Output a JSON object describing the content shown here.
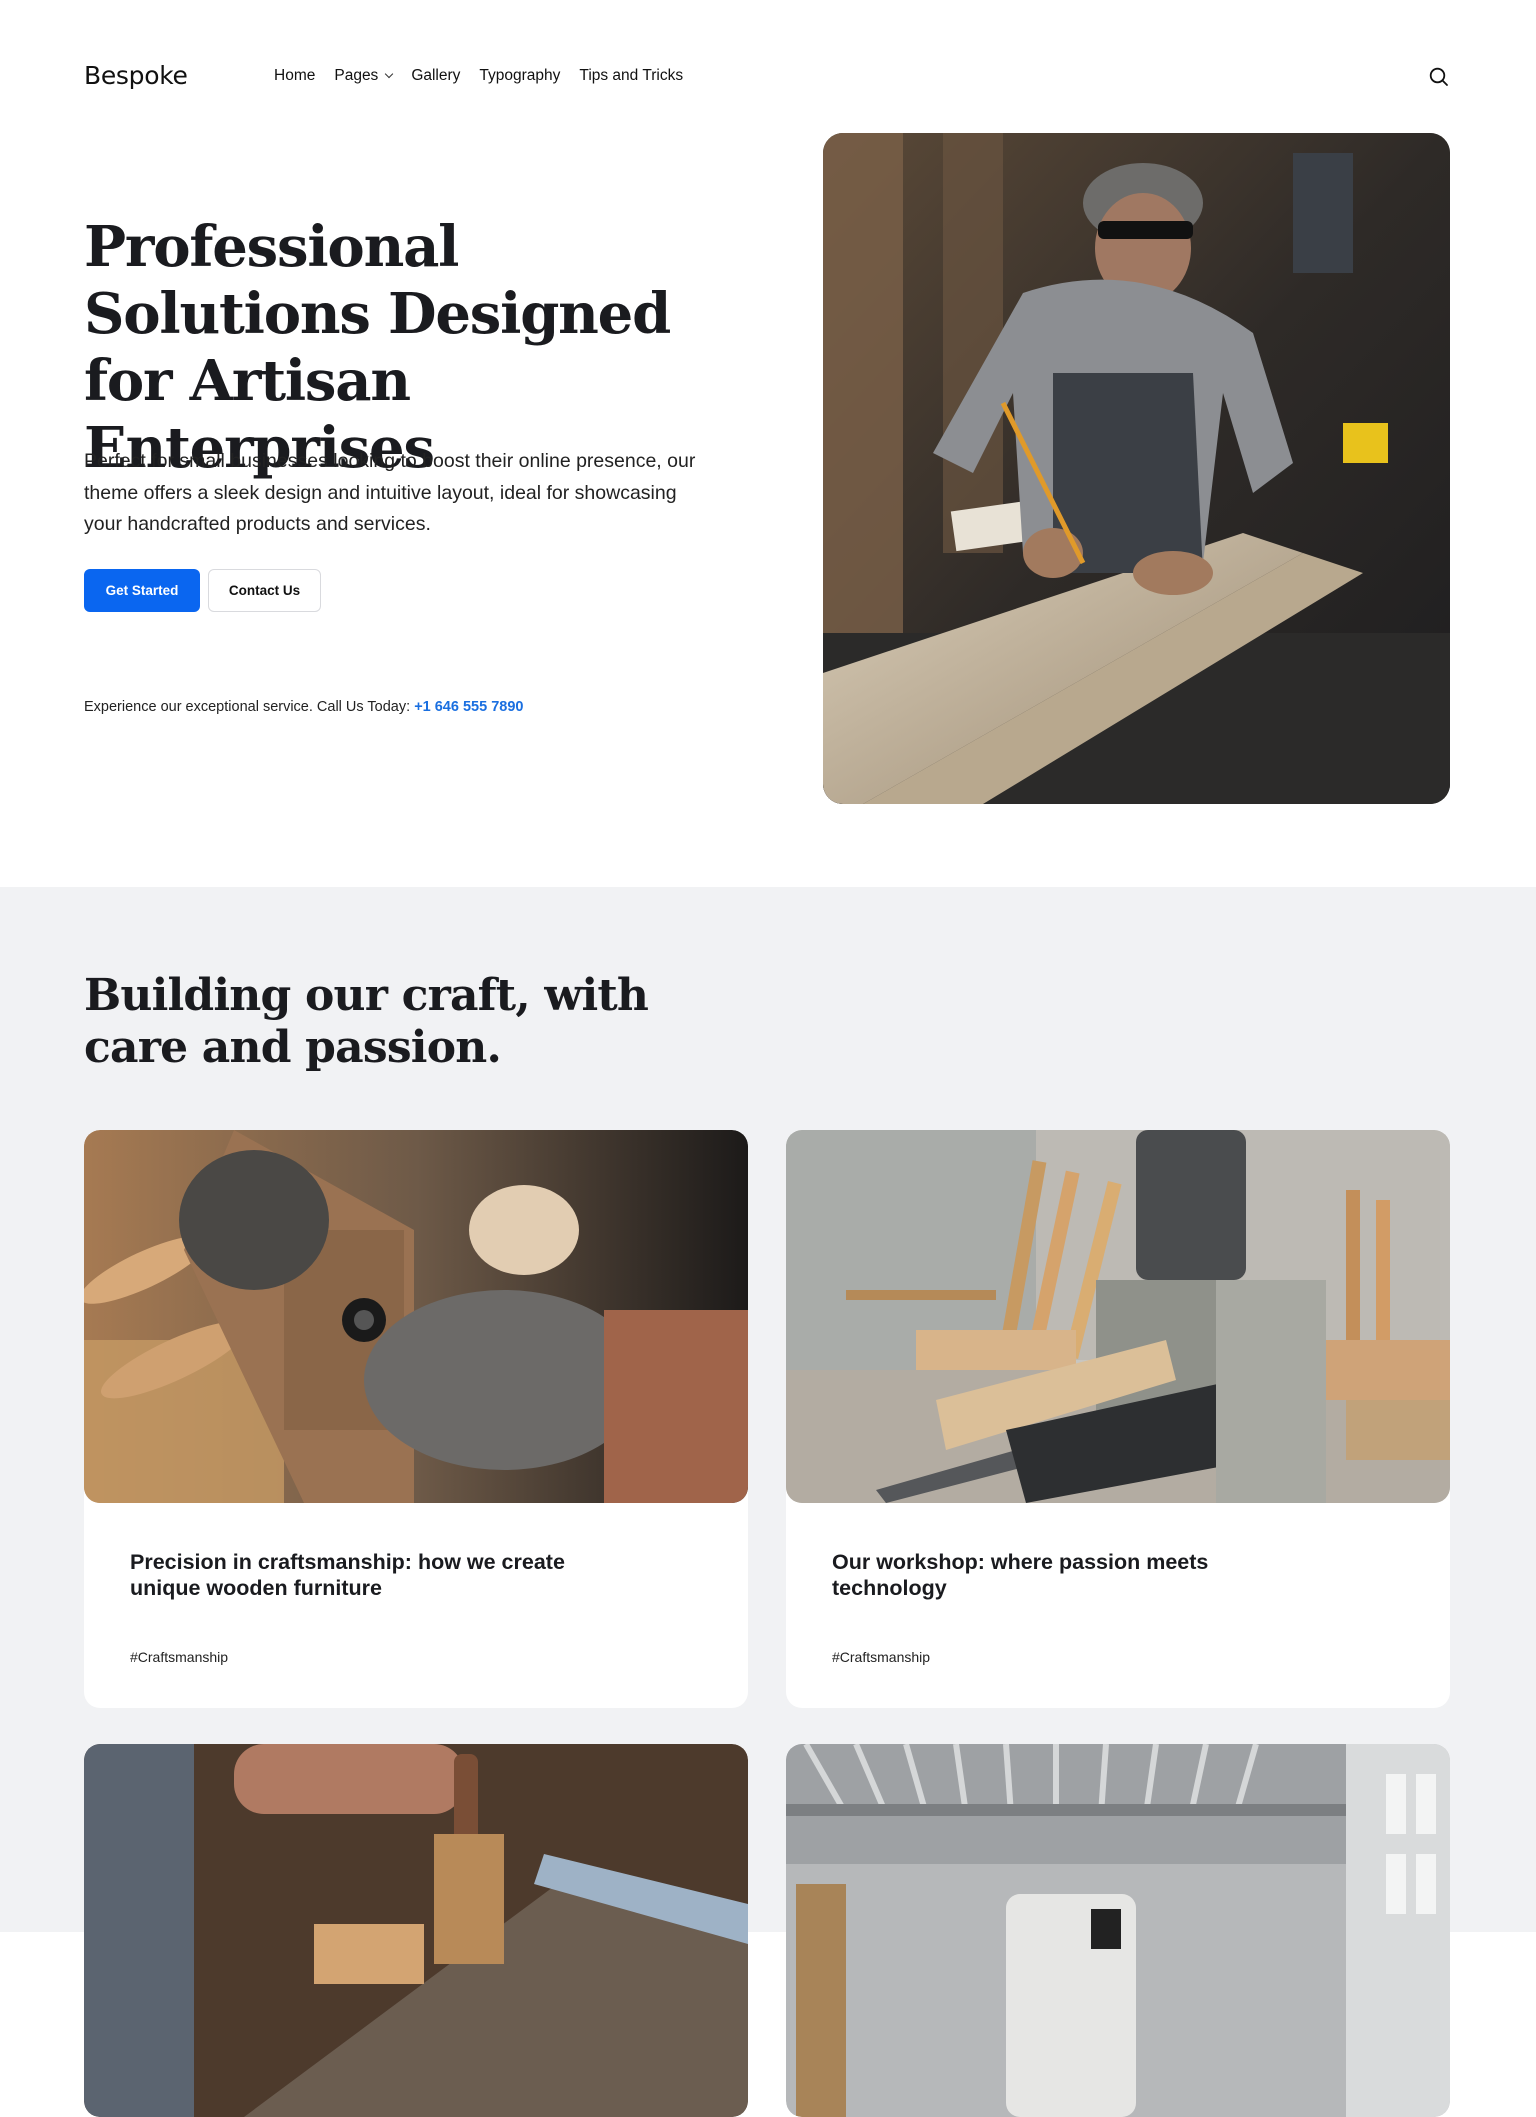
{
  "header": {
    "logo": "Bespoke",
    "nav": [
      {
        "label": "Home",
        "has_dropdown": false
      },
      {
        "label": "Pages",
        "has_dropdown": true
      },
      {
        "label": "Gallery",
        "has_dropdown": false
      },
      {
        "label": "Typography",
        "has_dropdown": false
      },
      {
        "label": "Tips and Tricks",
        "has_dropdown": false
      }
    ],
    "search_icon": "search-icon"
  },
  "hero": {
    "title": "Professional Solutions Designed for Artisan Enterprises",
    "description": "Perfect for small businesses looking to boost their online presence, our theme offers a sleek design and intuitive layout, ideal for showcasing your handcrafted products and services.",
    "primary_button": "Get Started",
    "secondary_button": "Contact Us",
    "call_text": "Experience our exceptional service. Call Us Today: ",
    "phone": "+1 646 555 7890",
    "image_alt": "Craftsman marking a wooden plank with a pencil in a workshop"
  },
  "section2": {
    "title": "Building our craft, with care and passion.",
    "cards": [
      {
        "title": "Precision in craftsmanship: how we create unique wooden furniture",
        "tag": "#Craftsmanship",
        "image_alt": "Gloved hands planing wood"
      },
      {
        "title": "Our workshop: where passion meets technology",
        "tag": "#Craftsmanship",
        "image_alt": "Wood planer machine in a workshop"
      },
      {
        "title": "",
        "tag": "",
        "image_alt": "Hand using a chisel and mallet on wood"
      },
      {
        "title": "",
        "tag": "",
        "image_alt": "Bright industrial workshop with machinery"
      }
    ]
  },
  "colors": {
    "accent": "#0a66f0",
    "phone_link": "#1a6fe0",
    "section_bg": "#f1f2f4",
    "text": "#1a1b1f"
  }
}
